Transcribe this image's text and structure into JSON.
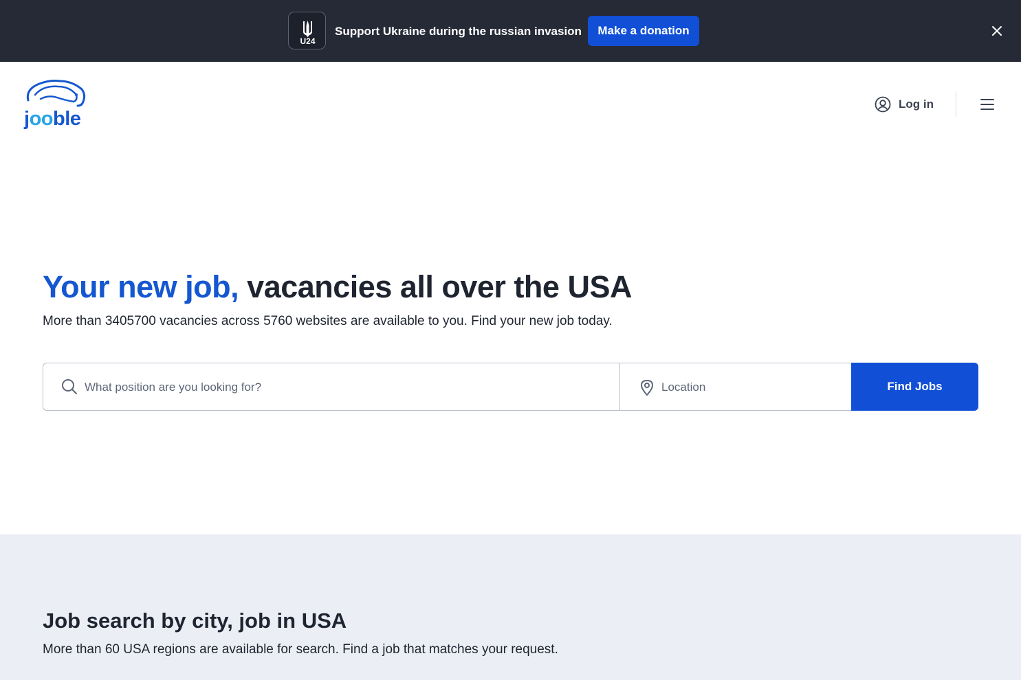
{
  "banner": {
    "logo_text": "U24",
    "message": "Support Ukraine during the russian invasion",
    "donate_label": "Make a donation",
    "close_icon": "close-icon"
  },
  "header": {
    "logo_text": "jooble",
    "login_label": "Log in",
    "login_icon": "user-circle-icon",
    "menu_icon": "hamburger-menu-icon"
  },
  "hero": {
    "title_accent": "Your new job,",
    "title_rest": " vacancies all over the USA",
    "subtitle": "More than 3405700 vacancies across 5760 websites are available to you. Find your new job today."
  },
  "search": {
    "position_placeholder": "What position are you looking for?",
    "position_value": "",
    "location_placeholder": "Location",
    "location_value": "",
    "button_label": "Find Jobs"
  },
  "cities": {
    "title": "Job search by city, job in USA",
    "subtitle": "More than 60 USA regions are available for search. Find a job that matches your request."
  },
  "colors": {
    "banner_bg": "#252a36",
    "accent": "#1557d0",
    "button": "#1150d6",
    "section_bg": "#ebeef5",
    "text": "#1f2530"
  }
}
